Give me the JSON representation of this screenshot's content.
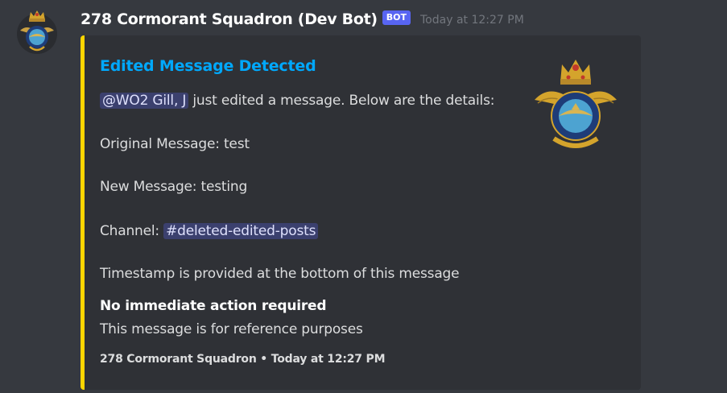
{
  "author": {
    "name": "278 Cormorant Squadron (Dev Bot)",
    "tag": "BOT",
    "timestamp": "Today at 12:27 PM",
    "avatar_icon": "rcaf-crest-icon"
  },
  "embed": {
    "color": "#ffd500",
    "title": "Edited Message Detected",
    "mention_user": "@WO2 Gill, J",
    "intro_text": " just edited a message. Below are the details:",
    "original_message": "Original Message: test",
    "new_message": "New Message: testing",
    "channel_label": "Channel: ",
    "channel_mention": "#deleted-edited-posts",
    "timestamp_note": "Timestamp is provided at the bottom of this message",
    "field_name": "No immediate action required",
    "field_value": "This message is for reference purposes",
    "thumbnail_icon": "rcaf-crest-icon",
    "footer": "278 Cormorant Squadron • Today at 12:27 PM"
  },
  "colors": {
    "background": "#36393f",
    "embed_background": "#2f3136",
    "title": "#00a8fc",
    "bot_tag": "#5865f2"
  }
}
